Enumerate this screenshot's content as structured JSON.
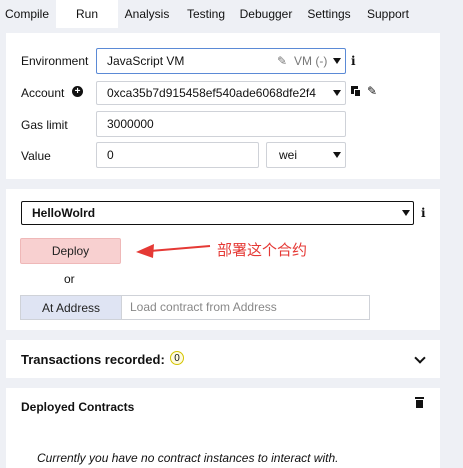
{
  "tabs": [
    {
      "label": "Compile"
    },
    {
      "label": "Run"
    },
    {
      "label": "Analysis"
    },
    {
      "label": "Testing"
    },
    {
      "label": "Debugger"
    },
    {
      "label": "Settings"
    },
    {
      "label": "Support"
    }
  ],
  "run": {
    "environment_label": "Environment",
    "environment_value": "JavaScript VM",
    "environment_vm": "VM (-)",
    "info_icon": "i",
    "account_label": "Account",
    "account_value": "0xca35b7d915458ef540ade6068dfe2f4",
    "gas_limit_label": "Gas limit",
    "gas_limit_value": "3000000",
    "value_label": "Value",
    "value_amount": "0",
    "value_unit": "wei"
  },
  "deploy": {
    "contract_select": "HelloWolrd",
    "deploy_button": "Deploy",
    "or_text": "or",
    "at_address_button": "At Address",
    "address_placeholder": "Load contract from Address",
    "annotation": "部署这个合约",
    "annotation_color": "#e53935"
  },
  "transactions": {
    "title": "Transactions recorded:",
    "count": "0"
  },
  "deployed": {
    "title": "Deployed Contracts",
    "empty_message": "Currently you have no contract instances to interact with."
  }
}
